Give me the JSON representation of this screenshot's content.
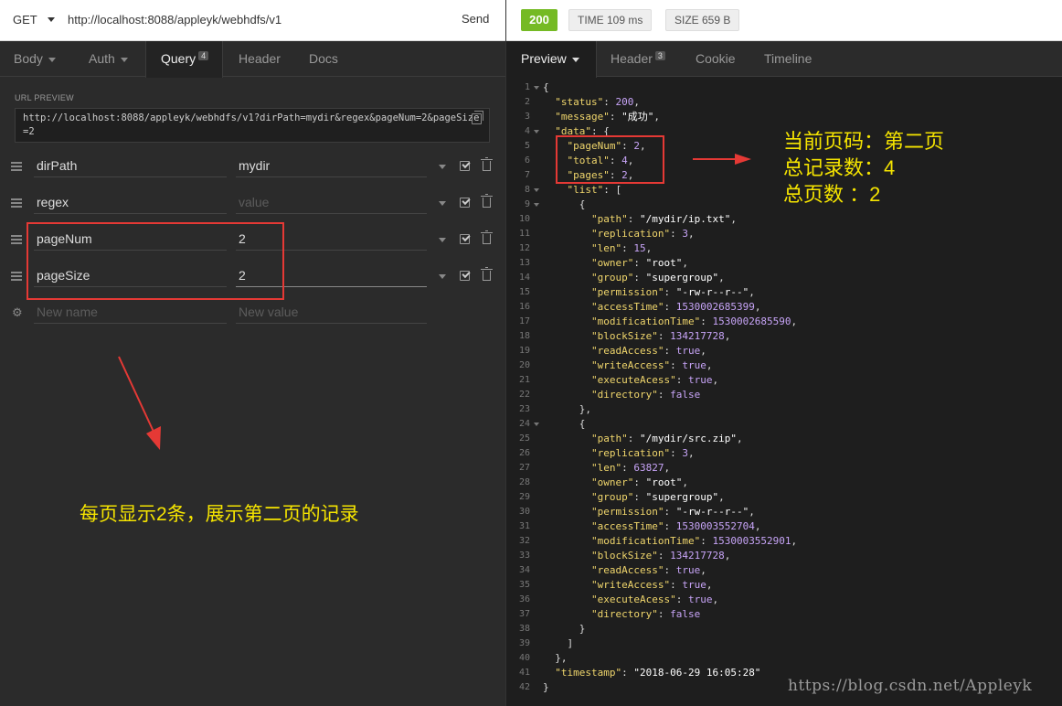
{
  "request": {
    "method": "GET",
    "url": "http://localhost:8088/appleyk/webhdfs/v1",
    "send_label": "Send"
  },
  "response_meta": {
    "status": "200",
    "time": "TIME 109 ms",
    "size": "SIZE 659 B"
  },
  "left_tabs": [
    {
      "label": "Body"
    },
    {
      "label": "Auth"
    },
    {
      "label": "Query",
      "badge": "4"
    },
    {
      "label": "Header"
    },
    {
      "label": "Docs"
    }
  ],
  "url_preview": {
    "label": "URL PREVIEW",
    "value": "http://localhost:8088/appleyk/webhdfs/v1?dirPath=mydir&regex&pageNum=2&pageSize=2"
  },
  "params": [
    {
      "name": "dirPath",
      "value": "mydir"
    },
    {
      "name": "regex",
      "value": "",
      "value_placeholder": "value"
    },
    {
      "name": "pageNum",
      "value": "2"
    },
    {
      "name": "pageSize",
      "value": "2"
    }
  ],
  "new_param": {
    "name_placeholder": "New name",
    "value_placeholder": "New value"
  },
  "right_tabs": [
    {
      "label": "Preview"
    },
    {
      "label": "Header",
      "badge": "3"
    },
    {
      "label": "Cookie"
    },
    {
      "label": "Timeline"
    }
  ],
  "annotations": {
    "left_note": "每页显示2条，展示第二页的记录",
    "right_note_1": "当前页码：第二页",
    "right_note_2": "总记录数：4",
    "right_note_3": "总页数 ：2"
  },
  "watermark": "https://blog.csdn.net/Appleyk",
  "json_lines": [
    {
      "n": "1",
      "fold": true,
      "t": [
        [
          "p",
          "{"
        ]
      ]
    },
    {
      "n": "2",
      "t": [
        [
          "p",
          "  "
        ],
        [
          "k",
          "\"status\""
        ],
        [
          "p",
          ": "
        ],
        [
          "n",
          "200"
        ],
        [
          "p",
          ","
        ]
      ]
    },
    {
      "n": "3",
      "t": [
        [
          "p",
          "  "
        ],
        [
          "k",
          "\"message\""
        ],
        [
          "p",
          ": "
        ],
        [
          "s",
          "\"成功\""
        ],
        [
          "p",
          ","
        ]
      ]
    },
    {
      "n": "4",
      "fold": true,
      "t": [
        [
          "p",
          "  "
        ],
        [
          "k",
          "\"data\""
        ],
        [
          "p",
          ": {"
        ]
      ]
    },
    {
      "n": "5",
      "t": [
        [
          "p",
          "    "
        ],
        [
          "k",
          "\"pageNum\""
        ],
        [
          "p",
          ": "
        ],
        [
          "n",
          "2"
        ],
        [
          "p",
          ","
        ]
      ]
    },
    {
      "n": "6",
      "t": [
        [
          "p",
          "    "
        ],
        [
          "k",
          "\"total\""
        ],
        [
          "p",
          ": "
        ],
        [
          "n",
          "4"
        ],
        [
          "p",
          ","
        ]
      ]
    },
    {
      "n": "7",
      "t": [
        [
          "p",
          "    "
        ],
        [
          "k",
          "\"pages\""
        ],
        [
          "p",
          ": "
        ],
        [
          "n",
          "2"
        ],
        [
          "p",
          ","
        ]
      ]
    },
    {
      "n": "8",
      "fold": true,
      "t": [
        [
          "p",
          "    "
        ],
        [
          "k",
          "\"list\""
        ],
        [
          "p",
          ": ["
        ]
      ]
    },
    {
      "n": "9",
      "fold": true,
      "t": [
        [
          "p",
          "      {"
        ]
      ]
    },
    {
      "n": "10",
      "t": [
        [
          "p",
          "        "
        ],
        [
          "k",
          "\"path\""
        ],
        [
          "p",
          ": "
        ],
        [
          "s",
          "\"/mydir/ip.txt\""
        ],
        [
          "p",
          ","
        ]
      ]
    },
    {
      "n": "11",
      "t": [
        [
          "p",
          "        "
        ],
        [
          "k",
          "\"replication\""
        ],
        [
          "p",
          ": "
        ],
        [
          "n",
          "3"
        ],
        [
          "p",
          ","
        ]
      ]
    },
    {
      "n": "12",
      "t": [
        [
          "p",
          "        "
        ],
        [
          "k",
          "\"len\""
        ],
        [
          "p",
          ": "
        ],
        [
          "n",
          "15"
        ],
        [
          "p",
          ","
        ]
      ]
    },
    {
      "n": "13",
      "t": [
        [
          "p",
          "        "
        ],
        [
          "k",
          "\"owner\""
        ],
        [
          "p",
          ": "
        ],
        [
          "s",
          "\"root\""
        ],
        [
          "p",
          ","
        ]
      ]
    },
    {
      "n": "14",
      "t": [
        [
          "p",
          "        "
        ],
        [
          "k",
          "\"group\""
        ],
        [
          "p",
          ": "
        ],
        [
          "s",
          "\"supergroup\""
        ],
        [
          "p",
          ","
        ]
      ]
    },
    {
      "n": "15",
      "t": [
        [
          "p",
          "        "
        ],
        [
          "k",
          "\"permission\""
        ],
        [
          "p",
          ": "
        ],
        [
          "s",
          "\"-rw-r--r--\""
        ],
        [
          "p",
          ","
        ]
      ]
    },
    {
      "n": "16",
      "t": [
        [
          "p",
          "        "
        ],
        [
          "k",
          "\"accessTime\""
        ],
        [
          "p",
          ": "
        ],
        [
          "n",
          "1530002685399"
        ],
        [
          "p",
          ","
        ]
      ]
    },
    {
      "n": "17",
      "t": [
        [
          "p",
          "        "
        ],
        [
          "k",
          "\"modificationTime\""
        ],
        [
          "p",
          ": "
        ],
        [
          "n",
          "1530002685590"
        ],
        [
          "p",
          ","
        ]
      ]
    },
    {
      "n": "18",
      "t": [
        [
          "p",
          "        "
        ],
        [
          "k",
          "\"blockSize\""
        ],
        [
          "p",
          ": "
        ],
        [
          "n",
          "134217728"
        ],
        [
          "p",
          ","
        ]
      ]
    },
    {
      "n": "19",
      "t": [
        [
          "p",
          "        "
        ],
        [
          "k",
          "\"readAccess\""
        ],
        [
          "p",
          ": "
        ],
        [
          "b",
          "true"
        ],
        [
          "p",
          ","
        ]
      ]
    },
    {
      "n": "20",
      "t": [
        [
          "p",
          "        "
        ],
        [
          "k",
          "\"writeAccess\""
        ],
        [
          "p",
          ": "
        ],
        [
          "b",
          "true"
        ],
        [
          "p",
          ","
        ]
      ]
    },
    {
      "n": "21",
      "t": [
        [
          "p",
          "        "
        ],
        [
          "k",
          "\"executeAcess\""
        ],
        [
          "p",
          ": "
        ],
        [
          "b",
          "true"
        ],
        [
          "p",
          ","
        ]
      ]
    },
    {
      "n": "22",
      "t": [
        [
          "p",
          "        "
        ],
        [
          "k",
          "\"directory\""
        ],
        [
          "p",
          ": "
        ],
        [
          "b",
          "false"
        ]
      ]
    },
    {
      "n": "23",
      "t": [
        [
          "p",
          "      },"
        ]
      ]
    },
    {
      "n": "24",
      "fold": true,
      "t": [
        [
          "p",
          "      {"
        ]
      ]
    },
    {
      "n": "25",
      "t": [
        [
          "p",
          "        "
        ],
        [
          "k",
          "\"path\""
        ],
        [
          "p",
          ": "
        ],
        [
          "s",
          "\"/mydir/src.zip\""
        ],
        [
          "p",
          ","
        ]
      ]
    },
    {
      "n": "26",
      "t": [
        [
          "p",
          "        "
        ],
        [
          "k",
          "\"replication\""
        ],
        [
          "p",
          ": "
        ],
        [
          "n",
          "3"
        ],
        [
          "p",
          ","
        ]
      ]
    },
    {
      "n": "27",
      "t": [
        [
          "p",
          "        "
        ],
        [
          "k",
          "\"len\""
        ],
        [
          "p",
          ": "
        ],
        [
          "n",
          "63827"
        ],
        [
          "p",
          ","
        ]
      ]
    },
    {
      "n": "28",
      "t": [
        [
          "p",
          "        "
        ],
        [
          "k",
          "\"owner\""
        ],
        [
          "p",
          ": "
        ],
        [
          "s",
          "\"root\""
        ],
        [
          "p",
          ","
        ]
      ]
    },
    {
      "n": "29",
      "t": [
        [
          "p",
          "        "
        ],
        [
          "k",
          "\"group\""
        ],
        [
          "p",
          ": "
        ],
        [
          "s",
          "\"supergroup\""
        ],
        [
          "p",
          ","
        ]
      ]
    },
    {
      "n": "30",
      "t": [
        [
          "p",
          "        "
        ],
        [
          "k",
          "\"permission\""
        ],
        [
          "p",
          ": "
        ],
        [
          "s",
          "\"-rw-r--r--\""
        ],
        [
          "p",
          ","
        ]
      ]
    },
    {
      "n": "31",
      "t": [
        [
          "p",
          "        "
        ],
        [
          "k",
          "\"accessTime\""
        ],
        [
          "p",
          ": "
        ],
        [
          "n",
          "1530003552704"
        ],
        [
          "p",
          ","
        ]
      ]
    },
    {
      "n": "32",
      "t": [
        [
          "p",
          "        "
        ],
        [
          "k",
          "\"modificationTime\""
        ],
        [
          "p",
          ": "
        ],
        [
          "n",
          "1530003552901"
        ],
        [
          "p",
          ","
        ]
      ]
    },
    {
      "n": "33",
      "t": [
        [
          "p",
          "        "
        ],
        [
          "k",
          "\"blockSize\""
        ],
        [
          "p",
          ": "
        ],
        [
          "n",
          "134217728"
        ],
        [
          "p",
          ","
        ]
      ]
    },
    {
      "n": "34",
      "t": [
        [
          "p",
          "        "
        ],
        [
          "k",
          "\"readAccess\""
        ],
        [
          "p",
          ": "
        ],
        [
          "b",
          "true"
        ],
        [
          "p",
          ","
        ]
      ]
    },
    {
      "n": "35",
      "t": [
        [
          "p",
          "        "
        ],
        [
          "k",
          "\"writeAccess\""
        ],
        [
          "p",
          ": "
        ],
        [
          "b",
          "true"
        ],
        [
          "p",
          ","
        ]
      ]
    },
    {
      "n": "36",
      "t": [
        [
          "p",
          "        "
        ],
        [
          "k",
          "\"executeAcess\""
        ],
        [
          "p",
          ": "
        ],
        [
          "b",
          "true"
        ],
        [
          "p",
          ","
        ]
      ]
    },
    {
      "n": "37",
      "t": [
        [
          "p",
          "        "
        ],
        [
          "k",
          "\"directory\""
        ],
        [
          "p",
          ": "
        ],
        [
          "b",
          "false"
        ]
      ]
    },
    {
      "n": "38",
      "t": [
        [
          "p",
          "      }"
        ]
      ]
    },
    {
      "n": "39",
      "t": [
        [
          "p",
          "    ]"
        ]
      ]
    },
    {
      "n": "40",
      "t": [
        [
          "p",
          "  },"
        ]
      ]
    },
    {
      "n": "41",
      "t": [
        [
          "p",
          "  "
        ],
        [
          "k",
          "\"timestamp\""
        ],
        [
          "p",
          ": "
        ],
        [
          "s",
          "\"2018-06-29 16:05:28\""
        ]
      ]
    },
    {
      "n": "42",
      "t": [
        [
          "p",
          "}"
        ]
      ]
    }
  ]
}
